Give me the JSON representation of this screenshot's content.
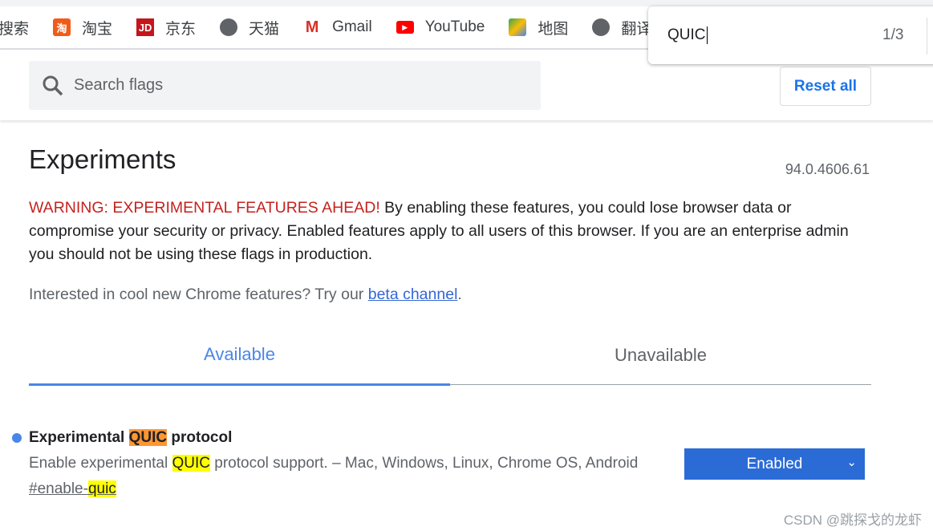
{
  "bookmarks": [
    {
      "label": "搜索",
      "icon": "search-engine-icon"
    },
    {
      "label": "淘宝",
      "icon": "taobao-icon",
      "color": "#f25b17"
    },
    {
      "label": "京东",
      "icon": "jd-icon",
      "color": "#c4161c"
    },
    {
      "label": "天猫",
      "icon": "globe-icon",
      "color": "#5f6368"
    },
    {
      "label": "Gmail",
      "icon": "gmail-icon",
      "color": "#d93025"
    },
    {
      "label": "YouTube",
      "icon": "youtube-icon",
      "color": "#ff0000"
    },
    {
      "label": "地图",
      "icon": "maps-icon",
      "color": "#34a853"
    },
    {
      "label": "翻译",
      "icon": "globe-icon",
      "color": "#5f6368"
    }
  ],
  "find": {
    "query": "QUIC",
    "count": "1/3"
  },
  "search": {
    "placeholder": "Search flags"
  },
  "reset_label": "Reset all",
  "title": "Experiments",
  "version": "94.0.4606.61",
  "warning": {
    "prefix": "WARNING: EXPERIMENTAL FEATURES AHEAD!",
    "text": " By enabling these features, you could lose browser data or compromise your security or privacy. Enabled features apply to all users of this browser. If you are an enterprise admin you should not be using these flags in production."
  },
  "interest": {
    "text": "Interested in cool new Chrome features? Try our ",
    "link": "beta channel",
    "end": "."
  },
  "tabs": [
    {
      "label": "Available",
      "active": true
    },
    {
      "label": "Unavailable",
      "active": false
    }
  ],
  "flag": {
    "title_pre": "Experimental ",
    "title_hl": "QUIC",
    "title_post": " protocol",
    "desc_pre": "Enable experimental ",
    "desc_hl": "QUIC",
    "desc_post": " protocol support. – Mac, Windows, Linux, Chrome OS, Android",
    "link_pre": "#enable-",
    "link_hl": "quic",
    "state": "Enabled"
  },
  "watermark": "CSDN @跳探戈的龙虾",
  "colors": {
    "accent": "#4a86e8",
    "select": "#2b6bd6",
    "warning": "#c5221f"
  }
}
